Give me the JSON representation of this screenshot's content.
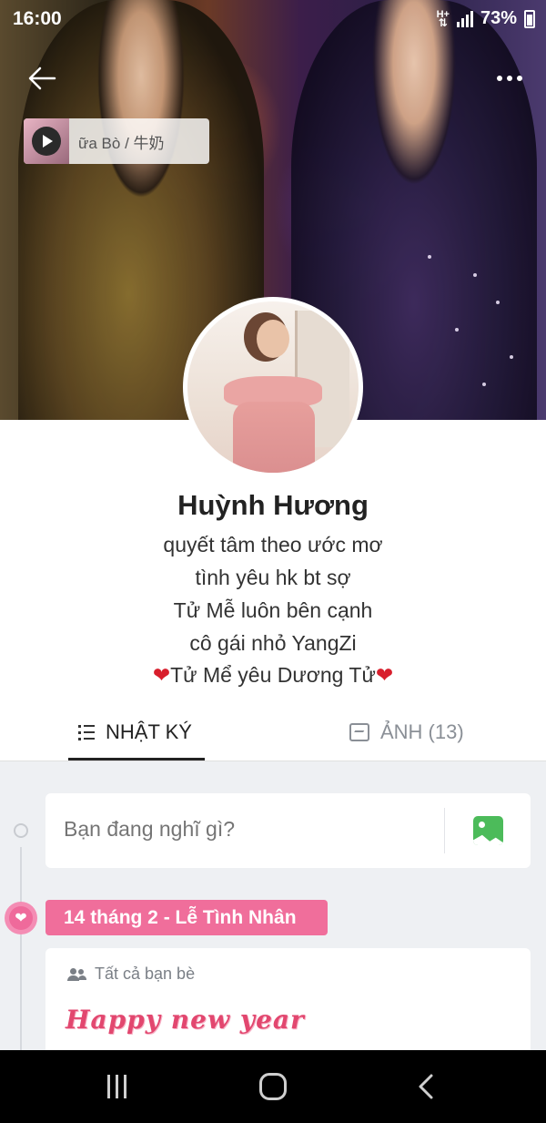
{
  "status_bar": {
    "time": "16:00",
    "network": "H+",
    "battery": "73%"
  },
  "music": {
    "title": "ữa Bò / 牛奶"
  },
  "profile": {
    "name": "Huỳnh Hương",
    "bio": [
      "quyết tâm theo ước mơ",
      "tình yêu hk bt sợ",
      "Tử Mễ luôn bên cạnh",
      "cô gái nhỏ YangZi",
      "❤️Tử Mể yêu Dương Tử❤️"
    ],
    "bio_last_prefix_heart": "❤",
    "bio_last_text": "Tử Mể yêu Dương Tử",
    "bio_last_suffix_heart": "❤"
  },
  "tabs": [
    {
      "label": "NHẬT KÝ",
      "active": true
    },
    {
      "label": "ẢNH (13)",
      "active": false
    }
  ],
  "compose": {
    "placeholder": "Bạn đang nghĩ gì?"
  },
  "event": {
    "label": "14 tháng 2 - Lễ Tình Nhân",
    "icon": "heart-icon"
  },
  "post": {
    "privacy": "Tất cả bạn bè",
    "content": "Happy new year"
  },
  "colors": {
    "accent_pink": "#f06e9b",
    "post_text": "#e2476f",
    "image_button": "#4cbb5a"
  }
}
